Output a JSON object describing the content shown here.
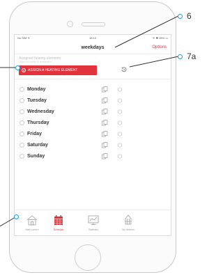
{
  "status_bar": {
    "carrier": "No SIM ✈",
    "time": "18:10",
    "battery": "✈ ✱ 35% ▭"
  },
  "header": {
    "title": "weekdays",
    "options_label": "Options"
  },
  "assigned": {
    "label": "Assigned heating elements:",
    "sublabel": "Touch the name to reselection",
    "button_label": "ASSIGN A HEATING ELEMENT"
  },
  "days": [
    "Monday",
    "Tuesday",
    "Wednesday",
    "Thursday",
    "Friday",
    "Saturday",
    "Sunday"
  ],
  "tabs": [
    {
      "label": "Main screen",
      "icon": "house-icon"
    },
    {
      "label": "Schedule",
      "icon": "calendar-icon"
    },
    {
      "label": "Statistics",
      "icon": "chart-icon"
    },
    {
      "label": "My devices",
      "icon": "radiator-icon"
    }
  ],
  "active_tab": "Schedule",
  "callouts": {
    "c6": "6",
    "c7a": "7a"
  },
  "colors": {
    "accent": "#e2323b",
    "callout": "#1aa0d8"
  }
}
